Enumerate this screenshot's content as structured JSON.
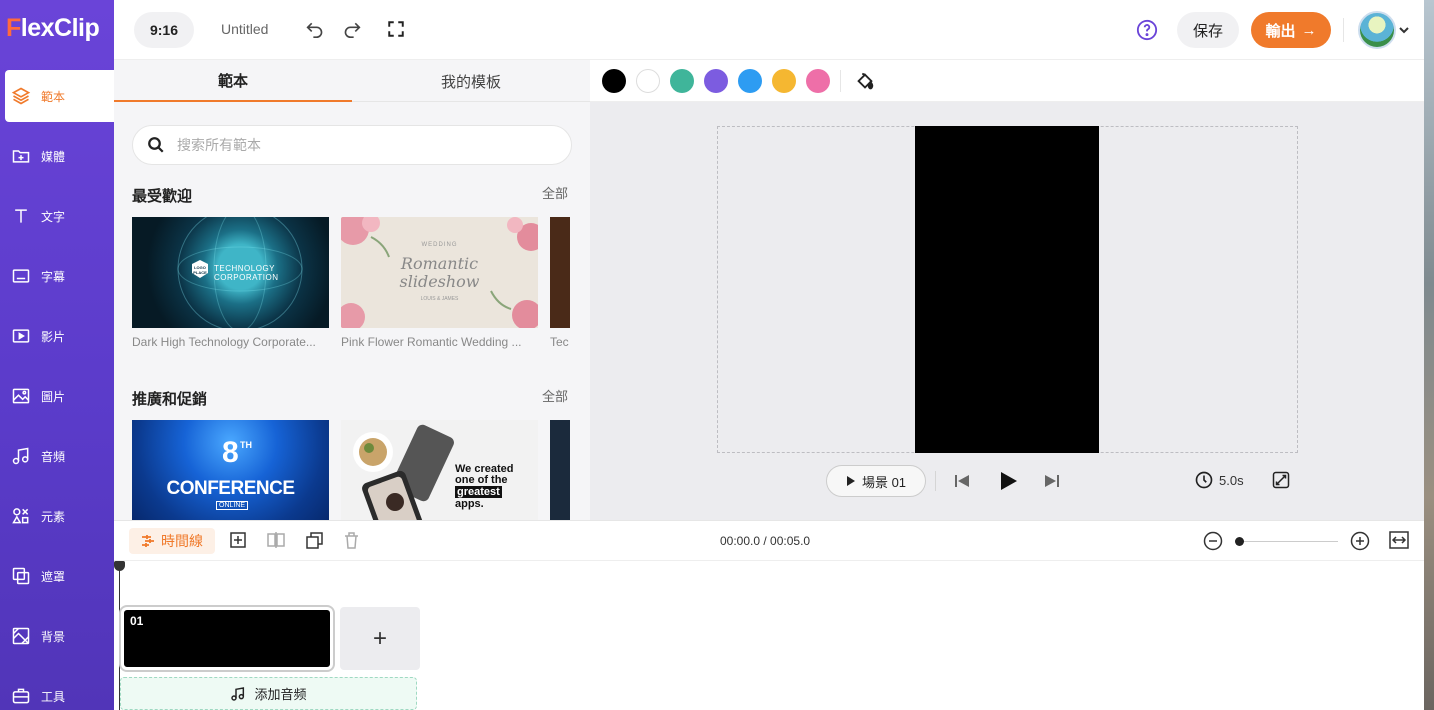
{
  "app": {
    "logo_text": "lexClip",
    "logo_initial": "F"
  },
  "sidebar": {
    "items": [
      {
        "label": "範本",
        "icon": "layers-icon"
      },
      {
        "label": "媒體",
        "icon": "folder-plus-icon"
      },
      {
        "label": "文字",
        "icon": "text-icon"
      },
      {
        "label": "字幕",
        "icon": "subtitle-icon"
      },
      {
        "label": "影片",
        "icon": "video-icon"
      },
      {
        "label": "圖片",
        "icon": "image-icon"
      },
      {
        "label": "音頻",
        "icon": "music-icon"
      },
      {
        "label": "元素",
        "icon": "elements-icon"
      },
      {
        "label": "遮罩",
        "icon": "mask-icon"
      },
      {
        "label": "背景",
        "icon": "background-icon"
      },
      {
        "label": "工具",
        "icon": "toolbox-icon"
      }
    ]
  },
  "topbar": {
    "ratio": "9:16",
    "title": "Untitled",
    "save_label": "保存",
    "export_label": "輸出",
    "export_arrow": "→"
  },
  "panel": {
    "tabs": [
      "範本",
      "我的模板"
    ],
    "search_placeholder": "搜索所有範本",
    "sections": [
      {
        "title": "最受歡迎",
        "all_label": "全部",
        "items": [
          {
            "caption": "Dark High Technology Corporate...",
            "thumb_text_1": "TECHNOLOGY",
            "thumb_text_2": "CORPORATION",
            "logo_text": "LOGO PLACE"
          },
          {
            "caption": "Pink Flower Romantic Wedding ...",
            "thumb_text_1": "WEDDING",
            "thumb_text_2": "Romantic",
            "thumb_text_3": "slideshow",
            "thumb_text_4": "LOUIS & JAMES"
          },
          {
            "caption": "Tec"
          }
        ]
      },
      {
        "title": "推廣和促銷",
        "all_label": "全部",
        "items": [
          {
            "thumb_text_1": "8",
            "thumb_text_sup": "TH",
            "thumb_text_2": "CONFERENCE",
            "thumb_text_3": "ONLINE"
          },
          {
            "thumb_text_1": "We created",
            "thumb_text_2": "one of the",
            "thumb_text_3": "greatest",
            "thumb_text_4": "apps."
          }
        ]
      }
    ]
  },
  "colorbar": {
    "colors": [
      "#000000",
      "#ffffff",
      "#3fb59a",
      "#7c5ce0",
      "#2d9cf2",
      "#f5b731",
      "#ee6fa8"
    ]
  },
  "stage": {
    "scene_label": "場景 01",
    "duration": "5.0s"
  },
  "timeline": {
    "label": "時間線",
    "timecode": "00:00.0 / 00:05.0",
    "clip_number": "01",
    "add_clip": "+",
    "add_audio": "添加音频"
  }
}
